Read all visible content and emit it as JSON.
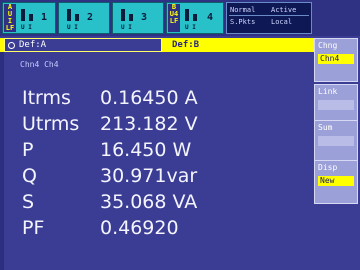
{
  "elements": [
    {
      "side": "A\nU I\nLF",
      "num": "1",
      "chnum": "1"
    },
    {
      "side": "",
      "num": "2",
      "chnum": "2"
    },
    {
      "side": "",
      "num": "3",
      "chnum": "3"
    },
    {
      "side": "B\nU4\nLF",
      "num": "4",
      "chnum": "4"
    }
  ],
  "status": {
    "r1c1": "Normal",
    "r1c2": "Active",
    "r2c1": "S.Pkts",
    "r2c2": "Local"
  },
  "tabs": {
    "active": "Def:A",
    "inactive": "Def:B"
  },
  "subheader": "Chn4 Ch4",
  "readings": [
    {
      "label": "Itrms",
      "value": "0.16450 A"
    },
    {
      "label": "Utrms",
      "value": "213.182 V"
    },
    {
      "label": "P",
      "value": "16.450 W"
    },
    {
      "label": "Q",
      "value": "30.971var"
    },
    {
      "label": "S",
      "value": "35.068 VA"
    },
    {
      "label": "PF",
      "value": "0.46920"
    }
  ],
  "softkeys": [
    {
      "title": "Chng",
      "value": "Chn4"
    },
    {
      "title": "Link",
      "value": ""
    },
    {
      "title": "Sum",
      "value": ""
    },
    {
      "title": "Disp",
      "value": "New"
    }
  ]
}
